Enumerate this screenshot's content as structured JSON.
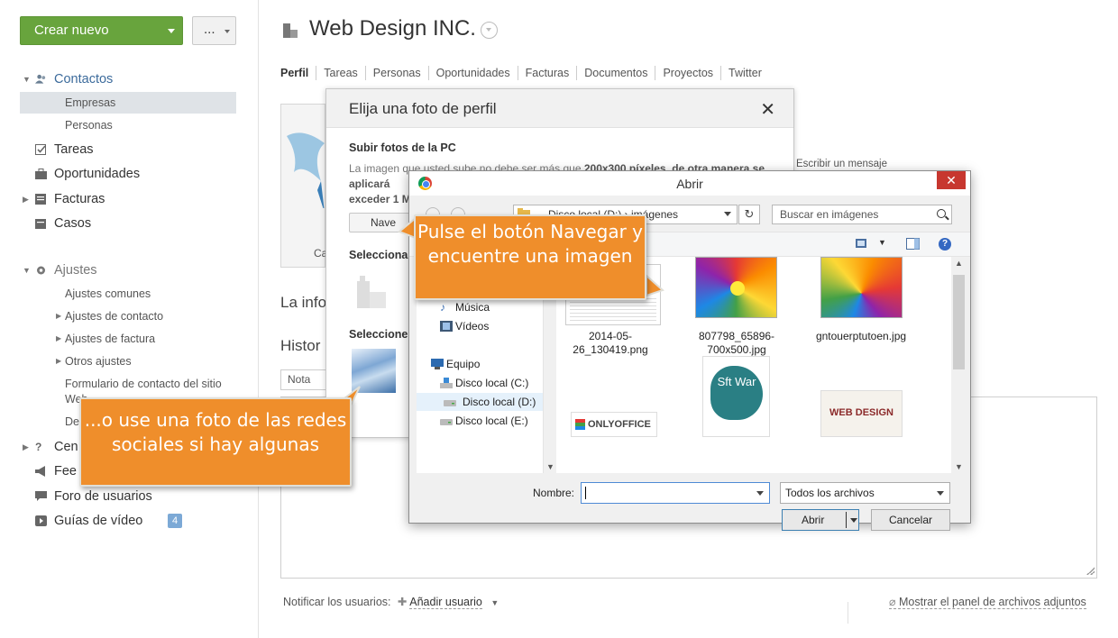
{
  "sidebar": {
    "create_label": "Crear nuevo",
    "more_label": "...",
    "contacts": {
      "label": "Contactos",
      "items": [
        "Empresas",
        "Personas"
      ]
    },
    "main_items": [
      "Tareas",
      "Oportunidades",
      "Facturas",
      "Casos"
    ],
    "settings": {
      "label": "Ajustes",
      "items": [
        "Ajustes comunes",
        "Ajustes de contacto",
        "Ajustes de factura",
        "Otros ajustes",
        "Formulario de contacto del sitio",
        "Web",
        "De"
      ]
    },
    "bottom_items": [
      "Cen",
      "Fee",
      "Foro de usuarios",
      "Guías de vídeo"
    ],
    "video_badge": "4"
  },
  "page": {
    "title": "Web Design INC.",
    "tabs": [
      "Perfil",
      "Tareas",
      "Personas",
      "Oportunidades",
      "Facturas",
      "Documentos",
      "Proyectos",
      "Twitter"
    ],
    "profile_caption": "Ca",
    "info_label": "La info",
    "history_label": "Histor",
    "note_tab": "Nota",
    "write_message": "Escribir un mensaje",
    "notify_label": "Notificar los usuarios:",
    "add_user": "Añadir usuario",
    "attach_panel": "Mostrar el panel de archivos adjuntos"
  },
  "photo_modal": {
    "title": "Elija una foto de perfil",
    "close": "✕",
    "upload_heading": "Subir fotos de la PC",
    "upload_desc_1": "La imagen que usted sube no debe ser más que ",
    "upload_desc_bold_1": "200x300 píxeles, de otra manera se aplicará",
    "upload_desc_bold_2": "exceder 1 M",
    "browse_label": "Nave",
    "select_default": "Seleccionar",
    "select_social": "Seleccione"
  },
  "file_dialog": {
    "title": "Abrir",
    "close": "✕",
    "address": "Disco local (D:) › imágenes",
    "search_placeholder": "Buscar en imágenes",
    "help": "?",
    "tree": [
      "Música",
      "Vídeos",
      "Equipo",
      "Disco local (C:)",
      "Disco local (D:)",
      "Disco local (E:)"
    ],
    "files": [
      {
        "name": "2014-05-26_130419.png"
      },
      {
        "name": "807798_65896-700x500.jpg"
      },
      {
        "name": "gntouerptutoen.jpg"
      }
    ],
    "thumb_text": {
      "onlyoffice": "ONLYOFFICE",
      "software": "Sft War",
      "webdesign": "WEB DESIGN"
    },
    "name_label": "Nombre:",
    "name_value": "",
    "file_type": "Todos los archivos",
    "open_label": "Abrir",
    "cancel_label": "Cancelar"
  },
  "callouts": {
    "browse_hint": "Pulse el botón Navegar y encuentre una imagen",
    "social_hint": "...o use una foto de las redes sociales si hay algunas"
  }
}
